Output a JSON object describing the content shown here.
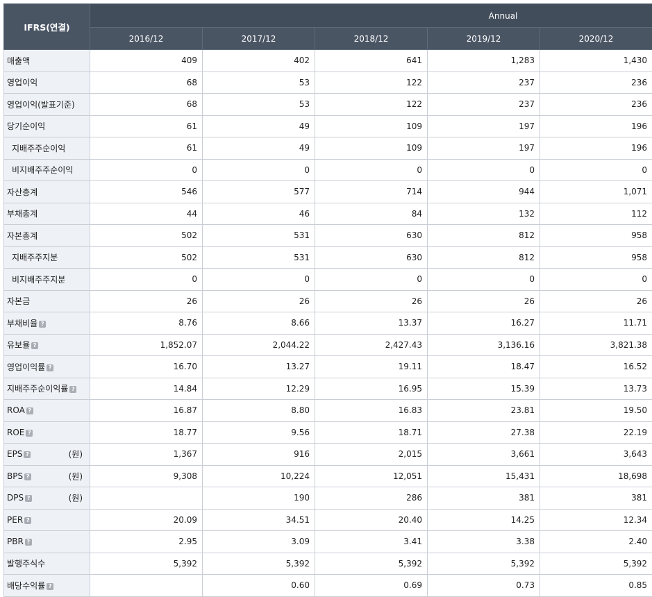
{
  "header": {
    "corner": "IFRS(연결)",
    "group": "Annual",
    "years": [
      "2016/12",
      "2017/12",
      "2018/12",
      "2019/12",
      "2020/12"
    ]
  },
  "help_icon_glyph": "?",
  "rows": [
    {
      "label": "매출액",
      "indent": false,
      "help": false,
      "unit": "",
      "values": [
        "409",
        "402",
        "641",
        "1,283",
        "1,430"
      ]
    },
    {
      "label": "영업이익",
      "indent": false,
      "help": false,
      "unit": "",
      "values": [
        "68",
        "53",
        "122",
        "237",
        "236"
      ]
    },
    {
      "label": "영업이익(발표기준)",
      "indent": false,
      "help": false,
      "unit": "",
      "values": [
        "68",
        "53",
        "122",
        "237",
        "236"
      ]
    },
    {
      "label": "당기순이익",
      "indent": false,
      "help": false,
      "unit": "",
      "values": [
        "61",
        "49",
        "109",
        "197",
        "196"
      ]
    },
    {
      "label": "지배주주순이익",
      "indent": true,
      "help": false,
      "unit": "",
      "values": [
        "61",
        "49",
        "109",
        "197",
        "196"
      ]
    },
    {
      "label": "비지배주주순이익",
      "indent": true,
      "help": false,
      "unit": "",
      "values": [
        "0",
        "0",
        "0",
        "0",
        "0"
      ]
    },
    {
      "label": "자산총계",
      "indent": false,
      "help": false,
      "unit": "",
      "values": [
        "546",
        "577",
        "714",
        "944",
        "1,071"
      ]
    },
    {
      "label": "부채총계",
      "indent": false,
      "help": false,
      "unit": "",
      "values": [
        "44",
        "46",
        "84",
        "132",
        "112"
      ]
    },
    {
      "label": "자본총계",
      "indent": false,
      "help": false,
      "unit": "",
      "values": [
        "502",
        "531",
        "630",
        "812",
        "958"
      ]
    },
    {
      "label": "지배주주지분",
      "indent": true,
      "help": false,
      "unit": "",
      "values": [
        "502",
        "531",
        "630",
        "812",
        "958"
      ]
    },
    {
      "label": "비지배주주지분",
      "indent": true,
      "help": false,
      "unit": "",
      "values": [
        "0",
        "0",
        "0",
        "0",
        "0"
      ]
    },
    {
      "label": "자본금",
      "indent": false,
      "help": false,
      "unit": "",
      "values": [
        "26",
        "26",
        "26",
        "26",
        "26"
      ]
    },
    {
      "label": "부채비율",
      "indent": false,
      "help": true,
      "unit": "",
      "values": [
        "8.76",
        "8.66",
        "13.37",
        "16.27",
        "11.71"
      ]
    },
    {
      "label": "유보율",
      "indent": false,
      "help": true,
      "unit": "",
      "values": [
        "1,852.07",
        "2,044.22",
        "2,427.43",
        "3,136.16",
        "3,821.38"
      ]
    },
    {
      "label": "영업이익률",
      "indent": false,
      "help": true,
      "unit": "",
      "values": [
        "16.70",
        "13.27",
        "19.11",
        "18.47",
        "16.52"
      ]
    },
    {
      "label": "지배주주순이익률",
      "indent": false,
      "help": true,
      "unit": "",
      "values": [
        "14.84",
        "12.29",
        "16.95",
        "15.39",
        "13.73"
      ]
    },
    {
      "label": "ROA",
      "indent": false,
      "help": true,
      "unit": "",
      "values": [
        "16.87",
        "8.80",
        "16.83",
        "23.81",
        "19.50"
      ]
    },
    {
      "label": "ROE",
      "indent": false,
      "help": true,
      "unit": "",
      "values": [
        "18.77",
        "9.56",
        "18.71",
        "27.38",
        "22.19"
      ]
    },
    {
      "label": "EPS",
      "indent": false,
      "help": true,
      "unit": "(원)",
      "values": [
        "1,367",
        "916",
        "2,015",
        "3,661",
        "3,643"
      ]
    },
    {
      "label": "BPS",
      "indent": false,
      "help": true,
      "unit": "(원)",
      "values": [
        "9,308",
        "10,224",
        "12,051",
        "15,431",
        "18,698"
      ]
    },
    {
      "label": "DPS",
      "indent": false,
      "help": true,
      "unit": "(원)",
      "values": [
        "",
        "190",
        "286",
        "381",
        "381"
      ]
    },
    {
      "label": "PER",
      "indent": false,
      "help": true,
      "unit": "",
      "values": [
        "20.09",
        "34.51",
        "20.40",
        "14.25",
        "12.34"
      ]
    },
    {
      "label": "PBR",
      "indent": false,
      "help": true,
      "unit": "",
      "values": [
        "2.95",
        "3.09",
        "3.41",
        "3.38",
        "2.40"
      ]
    },
    {
      "label": "발행주식수",
      "indent": false,
      "help": false,
      "unit": "",
      "values": [
        "5,392",
        "5,392",
        "5,392",
        "5,392",
        "5,392"
      ]
    },
    {
      "label": "배당수익률",
      "indent": false,
      "help": true,
      "unit": "",
      "values": [
        "",
        "0.60",
        "0.69",
        "0.73",
        "0.85"
      ]
    }
  ]
}
